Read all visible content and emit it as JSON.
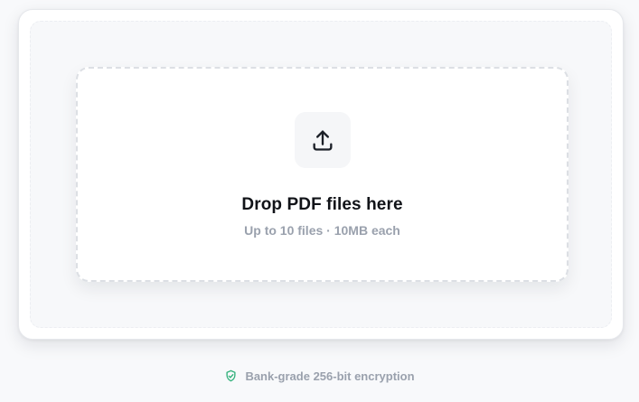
{
  "dropzone": {
    "icon": "upload-icon",
    "title": "Drop PDF files here",
    "subtitle": "Up to 10 files · 10MB each"
  },
  "footer": {
    "icon": "shield-check-icon",
    "security_text": "Bank-grade 256-bit encryption"
  },
  "colors": {
    "background": "#f8f9fb",
    "card": "#ffffff",
    "title": "#111318",
    "muted_text": "#9aa1ad",
    "accent_green": "#34b27d"
  }
}
